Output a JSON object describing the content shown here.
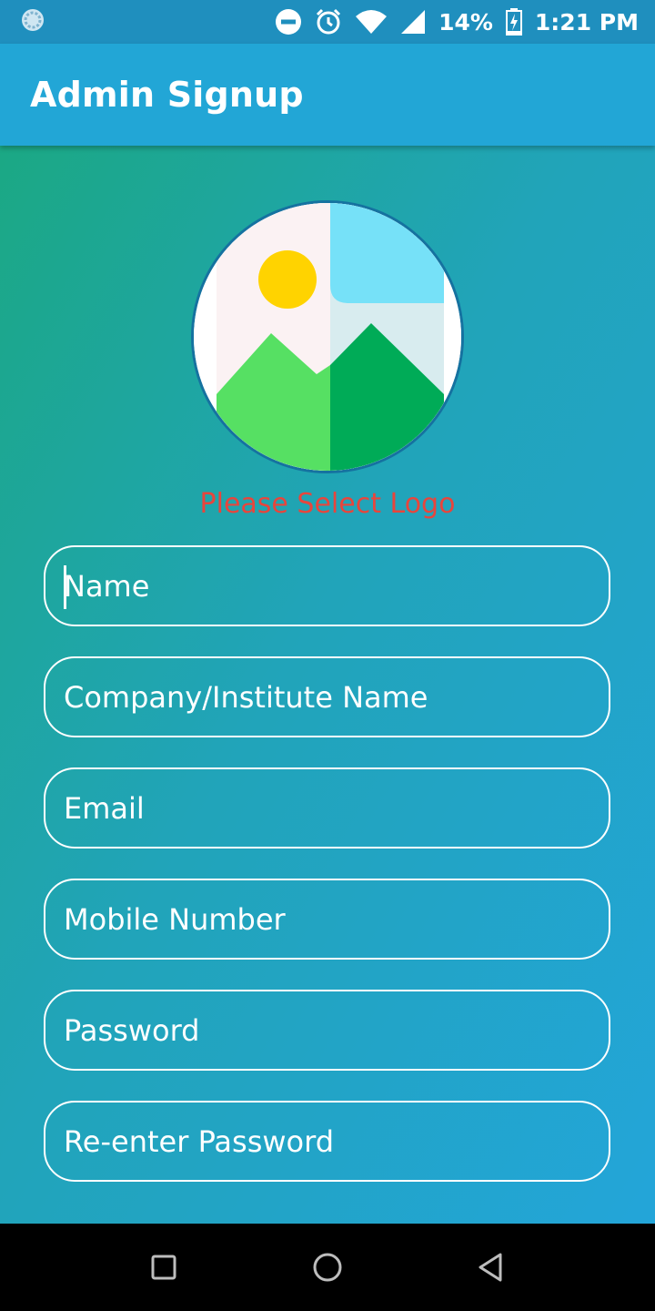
{
  "status_bar": {
    "battery": "14%",
    "time": "1:21 PM"
  },
  "app_bar": {
    "title": "Admin Signup"
  },
  "logo": {
    "hint": "Please Select Logo",
    "hint_color": "#e8453c"
  },
  "form": {
    "fields": [
      {
        "placeholder": "Name",
        "value": ""
      },
      {
        "placeholder": "Company/Institute Name",
        "value": ""
      },
      {
        "placeholder": "Email",
        "value": ""
      },
      {
        "placeholder": "Mobile Number",
        "value": ""
      },
      {
        "placeholder": "Password",
        "value": ""
      },
      {
        "placeholder": "Re-enter Password",
        "value": ""
      }
    ]
  },
  "colors": {
    "app_bar": "#22a6d6",
    "status_bar": "#1f8fbe",
    "gradient_start": "#1ba884",
    "gradient_end": "#23a5d9"
  }
}
